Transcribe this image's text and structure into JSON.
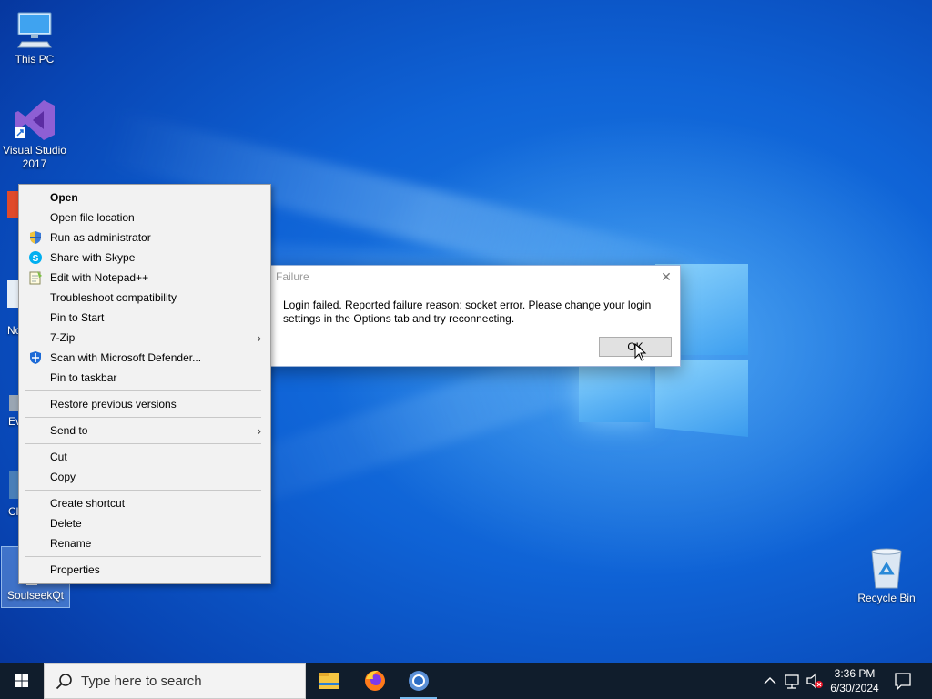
{
  "desktop": {
    "icons": {
      "this_pc": "This PC",
      "visual_studio": "Visual Studio 2017",
      "soulseek": "SoulseekQt",
      "recycle_bin": "Recycle Bin"
    },
    "partial_labels": [
      "No",
      "Ev",
      "Cl"
    ]
  },
  "dialog": {
    "title": "Failure",
    "message": "Login failed. Reported failure reason: socket error. Please change your login settings in the Options tab and try reconnecting.",
    "ok_label": "OK",
    "close_glyph": "✕"
  },
  "context_menu": {
    "groups": [
      [
        {
          "label": "Open",
          "bold": true,
          "icon": null
        },
        {
          "label": "Open file location",
          "icon": null
        },
        {
          "label": "Run as administrator",
          "icon": "uac-shield-icon"
        },
        {
          "label": "Share with Skype",
          "icon": "skype-icon"
        },
        {
          "label": "Edit with Notepad++",
          "icon": "notepadpp-icon"
        },
        {
          "label": "Troubleshoot compatibility",
          "icon": null
        },
        {
          "label": "Pin to Start",
          "icon": null
        },
        {
          "label": "7-Zip",
          "icon": null,
          "submenu": true
        },
        {
          "label": "Scan with Microsoft Defender...",
          "icon": "defender-icon"
        },
        {
          "label": "Pin to taskbar",
          "icon": null
        }
      ],
      [
        {
          "label": "Restore previous versions",
          "icon": null
        }
      ],
      [
        {
          "label": "Send to",
          "icon": null,
          "submenu": true
        }
      ],
      [
        {
          "label": "Cut",
          "icon": null
        },
        {
          "label": "Copy",
          "icon": null
        }
      ],
      [
        {
          "label": "Create shortcut",
          "icon": null
        },
        {
          "label": "Delete",
          "icon": null
        },
        {
          "label": "Rename",
          "icon": null
        }
      ],
      [
        {
          "label": "Properties",
          "icon": null
        }
      ]
    ],
    "submenu_arrow": "›"
  },
  "taskbar": {
    "search_placeholder": "Type here to search",
    "apps": [
      "file-explorer-icon",
      "firefox-icon",
      "chrome-icon"
    ],
    "tray_icons": [
      "chevron-up-icon",
      "network-icon",
      "volume-muted-icon"
    ],
    "time": "3:36 PM",
    "date": "6/30/2024"
  },
  "colors": {
    "taskbar": "#101d2c",
    "menu_bg": "#f2f2f2",
    "desktop_blue": "#0f63d6"
  }
}
